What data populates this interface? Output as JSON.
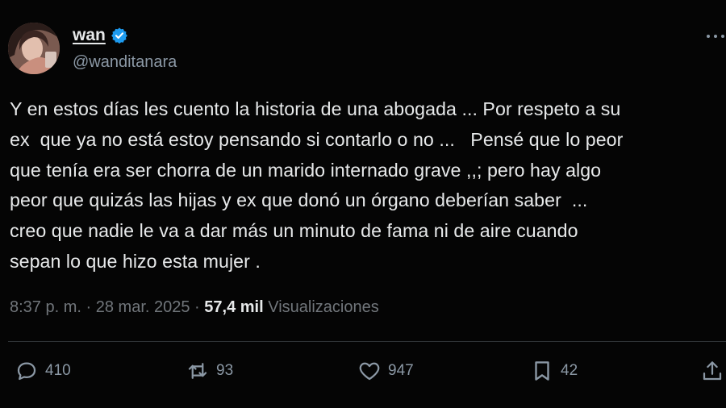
{
  "author": {
    "display_name": "wan",
    "handle": "@wanditanara",
    "verified": true,
    "verified_color": "#1d9bf0"
  },
  "tweet": {
    "lines": [
      "Y en estos días les cuento la historia de una abogada ... Por respeto a su",
      "ex  que ya no está estoy pensando si contarlo o no ...   Pensé que lo peor",
      "que tenía era ser chorra de un marido internado grave ,,; pero hay algo",
      "peor que quizás las hijas y ex que donó un órgano deberían saber  ...",
      "creo que nadie le va a dar más un minuto de fama ni de aire cuando",
      "sepan lo que hizo esta mujer ."
    ]
  },
  "meta": {
    "time": "8:37 p. m.",
    "separator": "·",
    "date": "28 mar. 2025",
    "views_count": "57,4 mil",
    "views_label": "Visualizaciones"
  },
  "actions": {
    "replies": {
      "icon": "reply-icon",
      "count": "410"
    },
    "reposts": {
      "icon": "repost-icon",
      "count": "93"
    },
    "likes": {
      "icon": "heart-icon",
      "count": "947"
    },
    "bookmarks": {
      "icon": "bookmark-icon",
      "count": "42"
    },
    "share": {
      "icon": "share-icon"
    }
  },
  "colors": {
    "background": "#050505",
    "text": "#e7e9ea",
    "muted": "#71767b",
    "divider": "#2f3336"
  }
}
